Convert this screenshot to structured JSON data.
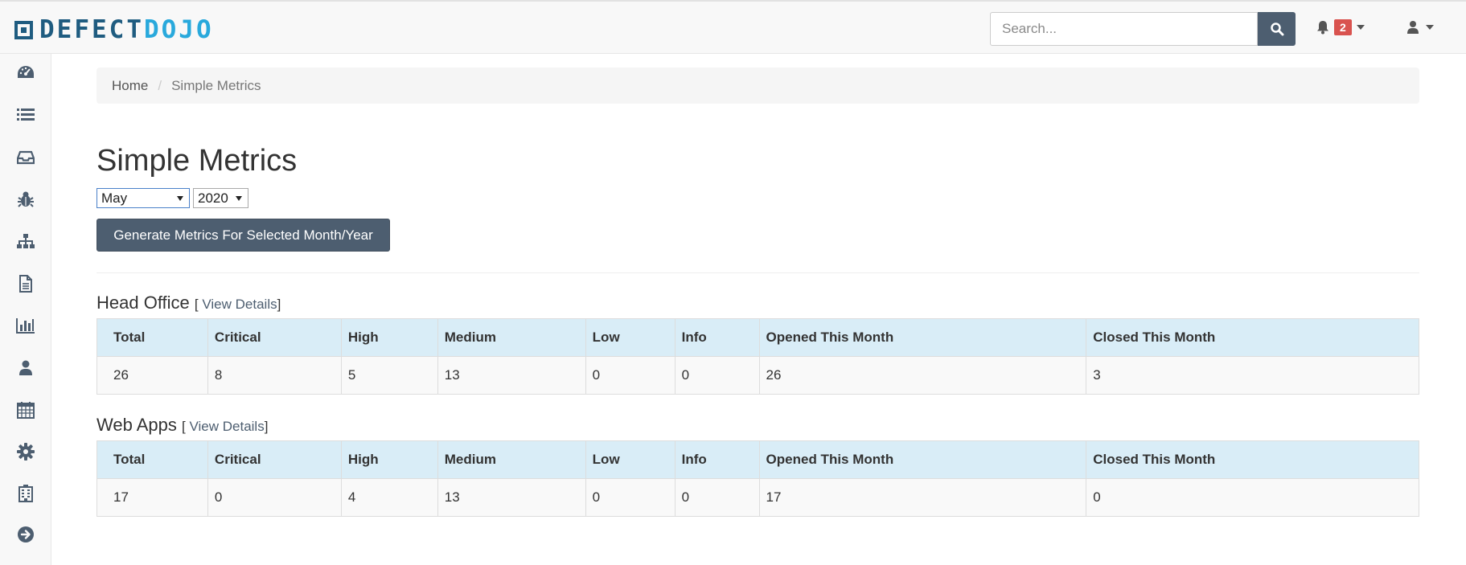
{
  "header": {
    "logo_text_1": "DEFECT",
    "logo_text_2": "DOJO",
    "search_placeholder": "Search...",
    "notification_count": "2",
    "search_icon": "search-icon",
    "bell_icon": "bell-icon",
    "user_icon": "user-icon"
  },
  "sidebar": {
    "items": [
      {
        "icon": "dashboard-icon"
      },
      {
        "icon": "list-icon"
      },
      {
        "icon": "inbox-icon"
      },
      {
        "icon": "bug-icon"
      },
      {
        "icon": "sitemap-icon"
      },
      {
        "icon": "file-icon"
      },
      {
        "icon": "bar-chart-icon"
      },
      {
        "icon": "user-icon"
      },
      {
        "icon": "calendar-icon"
      },
      {
        "icon": "gear-icon"
      },
      {
        "icon": "building-icon"
      },
      {
        "icon": "arrow-right-circle-icon"
      }
    ]
  },
  "breadcrumb": {
    "home": "Home",
    "separator": "/",
    "current": "Simple Metrics"
  },
  "page": {
    "title": "Simple Metrics",
    "month_selected": "May",
    "year_selected": "2020",
    "generate_label": "Generate Metrics For Selected Month/Year"
  },
  "columns": [
    "Total",
    "Critical",
    "High",
    "Medium",
    "Low",
    "Info",
    "Opened This Month",
    "Closed This Month"
  ],
  "sections": [
    {
      "name": "Head Office",
      "view_open": "[",
      "view_label": "View Details",
      "view_close": "]",
      "values": [
        "26",
        "8",
        "5",
        "13",
        "0",
        "0",
        "26",
        "3"
      ]
    },
    {
      "name": "Web Apps",
      "view_open": "[",
      "view_label": "View Details",
      "view_close": "]",
      "values": [
        "17",
        "0",
        "4",
        "13",
        "0",
        "0",
        "17",
        "0"
      ]
    }
  ],
  "colors": {
    "brand_dark": "#1f5c80",
    "brand_light": "#29a9dc",
    "button": "#4d5e70",
    "header_row": "#d9edf7",
    "badge": "#d9534f"
  }
}
